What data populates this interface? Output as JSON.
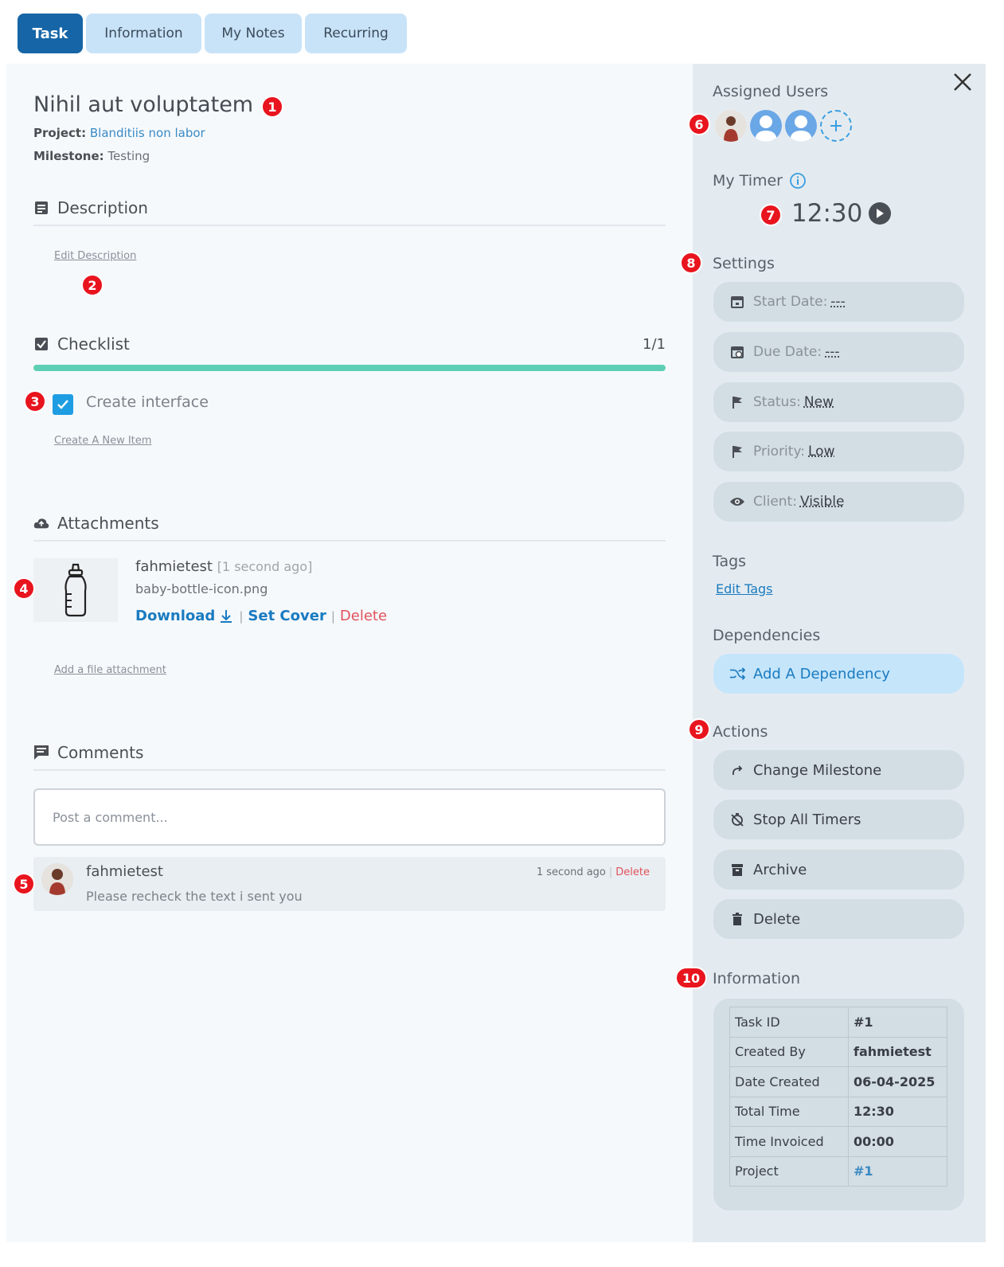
{
  "tabs": [
    {
      "label": "Task"
    },
    {
      "label": "Information"
    },
    {
      "label": "My Notes"
    },
    {
      "label": "Recurring"
    }
  ],
  "task": {
    "title": "Nihil aut voluptatem",
    "project_label": "Project:",
    "project_value": "Blanditiis non labor",
    "milestone_label": "Milestone:",
    "milestone_value": "Testing"
  },
  "description": {
    "heading": "Description",
    "edit_link": "Edit Description"
  },
  "checklist": {
    "heading": "Checklist",
    "count": "1/1",
    "progress": 1.0,
    "items": [
      {
        "label": "Create interface",
        "checked": true
      }
    ],
    "new_item_link": "Create A New Item"
  },
  "attachments": {
    "heading": "Attachments",
    "items": [
      {
        "user": "fahmietest",
        "time": "[1 second ago]",
        "filename": "baby-bottle-icon.png",
        "download_label": "Download",
        "set_cover_label": "Set Cover",
        "delete_label": "Delete",
        "sep": "|"
      }
    ],
    "add_link": "Add a file attachment"
  },
  "comments": {
    "heading": "Comments",
    "placeholder": "Post a comment...",
    "items": [
      {
        "user": "fahmietest",
        "text": "Please recheck the text i sent you",
        "time": "1 second ago",
        "sep": "|",
        "delete_label": "Delete"
      }
    ]
  },
  "sidebar": {
    "assigned_heading": "Assigned Users",
    "timer_heading": "My Timer",
    "timer_value": "12:30",
    "settings_heading": "Settings",
    "settings": [
      {
        "label": "Start Date:",
        "value": "---",
        "icon": "calendar-icon"
      },
      {
        "label": "Due Date:",
        "value": "---",
        "icon": "calendar-clock-icon"
      },
      {
        "label": "Status:",
        "value": "New",
        "icon": "flag-icon"
      },
      {
        "label": "Priority:",
        "value": "Low",
        "icon": "flag-icon"
      },
      {
        "label": "Client:",
        "value": "Visible",
        "icon": "eye-icon"
      }
    ],
    "tags_heading": "Tags",
    "edit_tags": "Edit Tags",
    "dependencies_heading": "Dependencies",
    "add_dependency": "Add A Dependency",
    "actions_heading": "Actions",
    "actions": [
      {
        "label": "Change Milestone",
        "icon": "redo-icon"
      },
      {
        "label": "Stop All Timers",
        "icon": "timer-off-icon"
      },
      {
        "label": "Archive",
        "icon": "archive-icon"
      },
      {
        "label": "Delete",
        "icon": "trash-icon"
      }
    ],
    "information_heading": "Information",
    "information": [
      {
        "label": "Task ID",
        "value": "#1"
      },
      {
        "label": "Created By",
        "value": "fahmietest"
      },
      {
        "label": "Date Created",
        "value": "06-04-2025"
      },
      {
        "label": "Total Time",
        "value": "12:30"
      },
      {
        "label": "Time Invoiced",
        "value": "00:00"
      },
      {
        "label": "Project",
        "value": "#1"
      }
    ]
  },
  "badges": [
    "1",
    "2",
    "3",
    "4",
    "5",
    "6",
    "7",
    "8",
    "9",
    "10"
  ],
  "colors": {
    "active_tab": "#1565a7",
    "tab": "#c8e3f8",
    "progress": "#5ecfb5",
    "badge": "#e8141e",
    "link": "#1a7bc0",
    "delete": "#e0525a"
  }
}
